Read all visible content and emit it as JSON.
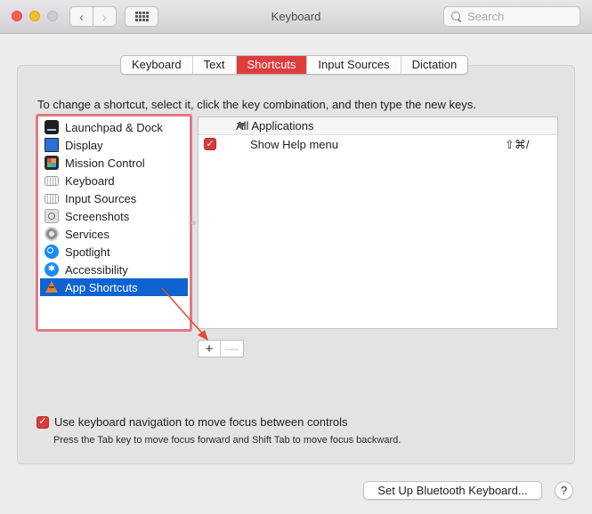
{
  "window": {
    "title": "Keyboard",
    "search_placeholder": "Search",
    "nav_back": "‹",
    "nav_forward": "›"
  },
  "tabs": [
    {
      "label": "Keyboard",
      "active": false
    },
    {
      "label": "Text",
      "active": false
    },
    {
      "label": "Shortcuts",
      "active": true
    },
    {
      "label": "Input Sources",
      "active": false
    },
    {
      "label": "Dictation",
      "active": false
    }
  ],
  "instructions": "To change a shortcut, select it, click the key combination, and then type the new keys.",
  "categories": [
    {
      "label": "Launchpad & Dock",
      "icon": "launchpad-icon"
    },
    {
      "label": "Display",
      "icon": "display-icon"
    },
    {
      "label": "Mission Control",
      "icon": "mission-control-icon"
    },
    {
      "label": "Keyboard",
      "icon": "keyboard-icon"
    },
    {
      "label": "Input Sources",
      "icon": "input-sources-icon"
    },
    {
      "label": "Screenshots",
      "icon": "screenshots-icon"
    },
    {
      "label": "Services",
      "icon": "services-gear-icon"
    },
    {
      "label": "Spotlight",
      "icon": "spotlight-icon"
    },
    {
      "label": "Accessibility",
      "icon": "accessibility-icon"
    },
    {
      "label": "App Shortcuts",
      "icon": "app-shortcuts-icon",
      "selected": true
    }
  ],
  "shortcuts": {
    "group_label": "All Applications",
    "rows": [
      {
        "label": "Show Help menu",
        "keys": "⇧⌘/",
        "checked": true
      }
    ]
  },
  "list_buttons": {
    "add": "+",
    "remove": "—"
  },
  "keyboard_navigation": {
    "label": "Use keyboard navigation to move focus between controls",
    "checked": true,
    "hint": "Press the Tab key to move focus forward and Shift Tab to move focus backward."
  },
  "bluetooth_button": "Set Up Bluetooth Keyboard...",
  "help_button": "?",
  "colors": {
    "accent_tab": "#df3d3b",
    "selection": "#0f63d1",
    "highlight_border": "#e27a82",
    "annotation_arrow": "#e24a3b",
    "checkbox": "#d83b3b"
  }
}
